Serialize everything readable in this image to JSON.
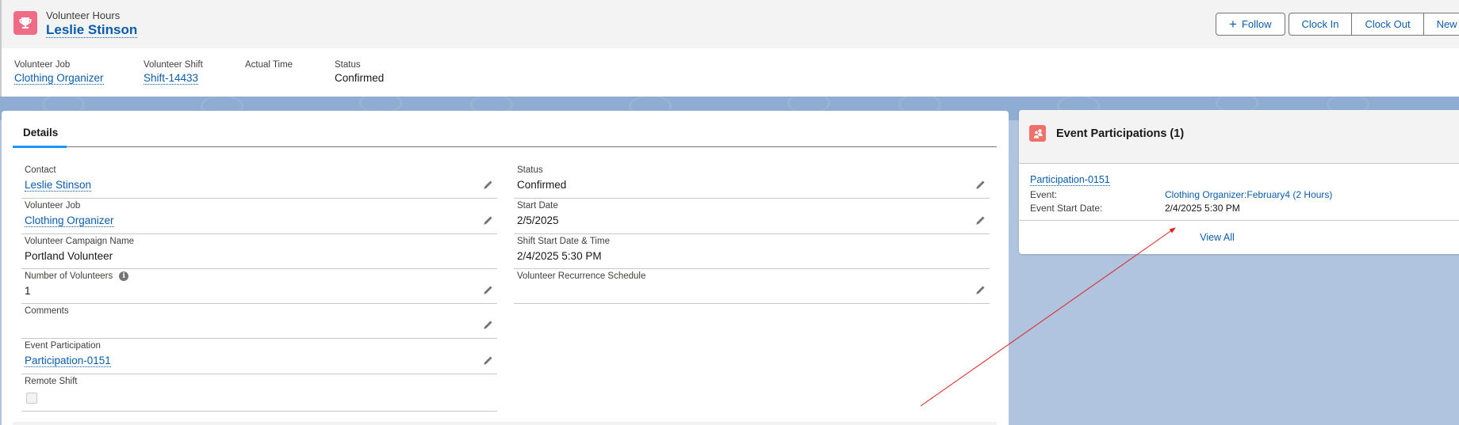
{
  "header": {
    "record_type": "Volunteer Hours",
    "record_name": "Leslie Stinson",
    "icon": "trophy-icon",
    "actions": {
      "follow_label": "Follow",
      "buttons": [
        "Clock In",
        "Clock Out",
        "New Case"
      ]
    },
    "highlights": [
      {
        "label": "Volunteer Job",
        "value": "Clothing Organizer",
        "is_link": true
      },
      {
        "label": "Volunteer Shift",
        "value": "Shift-14433",
        "is_link": true
      },
      {
        "label": "Actual Time",
        "value": "",
        "is_link": false
      },
      {
        "label": "Status",
        "value": "Confirmed",
        "is_link": false
      }
    ]
  },
  "details": {
    "tab_label": "Details",
    "left_fields": [
      {
        "label": "Contact",
        "value": "Leslie Stinson",
        "is_link": true,
        "editable": true
      },
      {
        "label": "Volunteer Job",
        "value": "Clothing Organizer",
        "is_link": true,
        "editable": true
      },
      {
        "label": "Volunteer Campaign Name",
        "value": "Portland Volunteer",
        "is_link": false,
        "editable": false
      },
      {
        "label": "Number of Volunteers",
        "value": "1",
        "is_link": false,
        "editable": true,
        "has_info": true
      },
      {
        "label": "Comments",
        "value": "",
        "is_link": false,
        "editable": true
      },
      {
        "label": "Event Participation",
        "value": "Participation-0151",
        "is_link": true,
        "editable": true
      },
      {
        "label": "Remote Shift",
        "value": false,
        "type": "checkbox",
        "editable": false
      }
    ],
    "right_fields": [
      {
        "label": "Status",
        "value": "Confirmed",
        "is_link": false,
        "editable": true
      },
      {
        "label": "Start Date",
        "value": "2/5/2025",
        "is_link": false,
        "editable": true
      },
      {
        "label": "Shift Start Date & Time",
        "value": "2/4/2025 5:30 PM",
        "is_link": false,
        "editable": false
      },
      {
        "label": "Volunteer Recurrence Schedule",
        "value": "",
        "is_link": false,
        "editable": true
      }
    ]
  },
  "related": {
    "title": "Event Participations (1)",
    "icon": "event-participation-icon",
    "record": {
      "name": "Participation-0151",
      "event_label": "Event:",
      "event_value": "Clothing Organizer:February4 (2 Hours)",
      "start_label": "Event Start Date:",
      "start_value": "2/4/2025 5:30 PM"
    },
    "view_all_label": "View All"
  },
  "colors": {
    "brand_link": "#0b5cab",
    "record_icon": "#f06c86",
    "related_icon": "#f0706a",
    "tab_active": "#1b96ff",
    "annotation_arrow": "#e02020"
  }
}
